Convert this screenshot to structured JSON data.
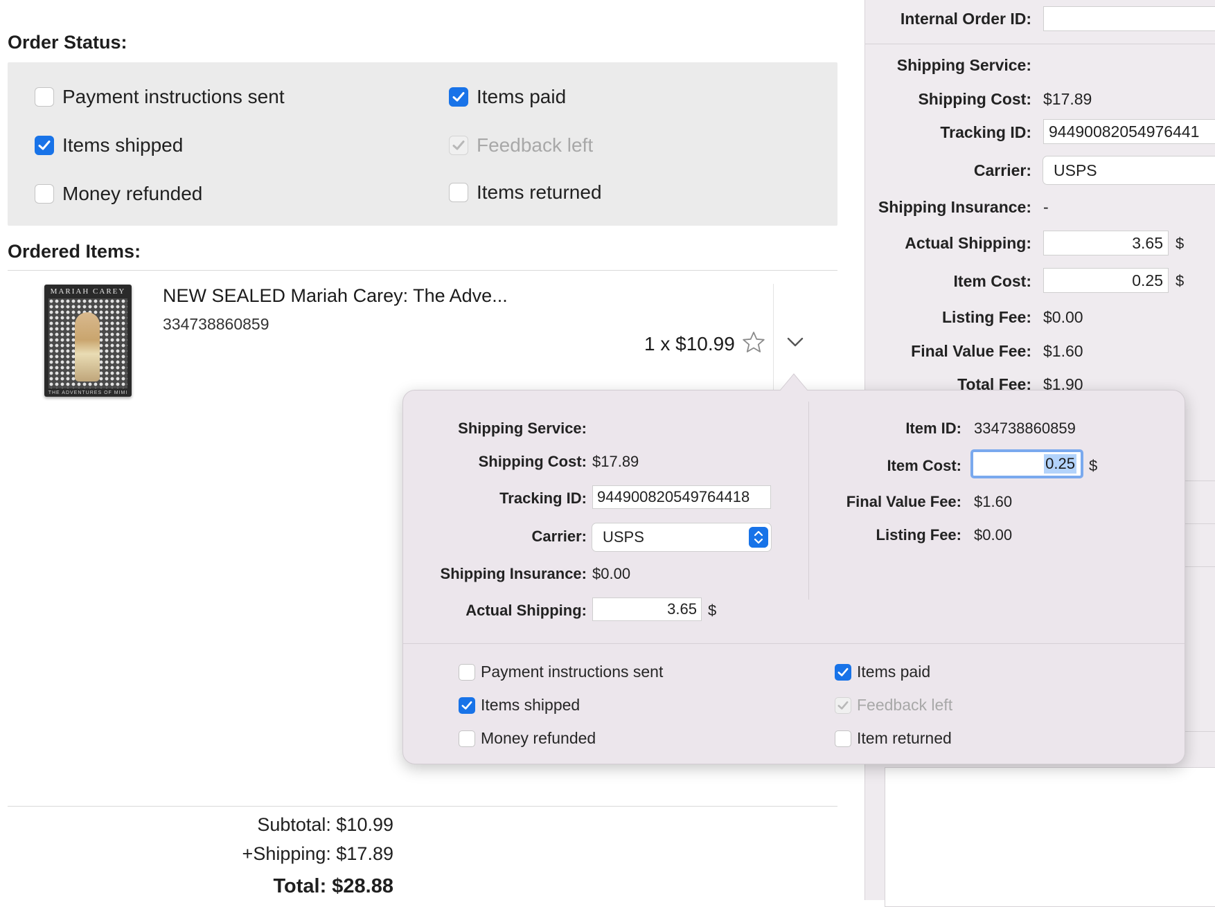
{
  "main": {
    "order_status_title": "Order Status:",
    "ordered_items_title": "Ordered Items:",
    "status_checkboxes": [
      {
        "label": "Payment instructions sent",
        "checked": false,
        "disabled": false
      },
      {
        "label": "Items paid",
        "checked": true,
        "disabled": false
      },
      {
        "label": "Items shipped",
        "checked": true,
        "disabled": false
      },
      {
        "label": "Feedback left",
        "checked": true,
        "disabled": true
      },
      {
        "label": "Money refunded",
        "checked": false,
        "disabled": false
      },
      {
        "label": "Items returned",
        "checked": false,
        "disabled": false
      }
    ],
    "item": {
      "title": "NEW SEALED Mariah Carey: The Adve...",
      "id": "334738860859",
      "price": "1 x $10.99",
      "thumb_brand": "MARIAH CAREY",
      "thumb_footer": "THE ADVENTURES OF MIMI"
    },
    "totals": {
      "subtotal": "Subtotal: $10.99",
      "shipping": "+Shipping: $17.89",
      "total": "Total: $28.88"
    }
  },
  "side": {
    "internal_order_id_label": "Internal Order ID:",
    "internal_order_id_value": "",
    "shipping_service_label": "Shipping Service:",
    "shipping_cost_label": "Shipping Cost:",
    "shipping_cost_value": "$17.89",
    "tracking_id_label": "Tracking ID:",
    "tracking_id_value": "94490082054976441",
    "carrier_label": "Carrier:",
    "carrier_value": "USPS",
    "shipping_insurance_label": "Shipping Insurance:",
    "shipping_insurance_value": "-",
    "actual_shipping_label": "Actual Shipping:",
    "actual_shipping_value": "3.65",
    "item_cost_label": "Item Cost:",
    "item_cost_value": "0.25",
    "listing_fee_label": "Listing Fee:",
    "listing_fee_value": "$0.00",
    "final_value_fee_label": "Final Value Fee:",
    "final_value_fee_value": "$1.60",
    "total_fee_label": "Total Fee:",
    "total_fee_value": "$1.90",
    "currency": "$"
  },
  "popover": {
    "shipping_service_label": "Shipping Service:",
    "shipping_cost_label": "Shipping Cost:",
    "shipping_cost_value": "$17.89",
    "tracking_id_label": "Tracking ID:",
    "tracking_id_value": "944900820549764418",
    "carrier_label": "Carrier:",
    "carrier_value": "USPS",
    "shipping_insurance_label": "Shipping Insurance:",
    "shipping_insurance_value": "$0.00",
    "actual_shipping_label": "Actual Shipping:",
    "actual_shipping_value": "3.65",
    "item_id_label": "Item ID:",
    "item_id_value": "334738860859",
    "item_cost_label": "Item Cost:",
    "item_cost_value": "0.25",
    "final_value_fee_label": "Final Value Fee:",
    "final_value_fee_value": "$1.60",
    "listing_fee_label": "Listing Fee:",
    "listing_fee_value": "$0.00",
    "currency": "$",
    "checkboxes": [
      {
        "label": "Payment instructions sent",
        "checked": false,
        "disabled": false
      },
      {
        "label": "Items paid",
        "checked": true,
        "disabled": false
      },
      {
        "label": "Items shipped",
        "checked": true,
        "disabled": false
      },
      {
        "label": "Feedback left",
        "checked": true,
        "disabled": true
      },
      {
        "label": "Money refunded",
        "checked": false,
        "disabled": false
      },
      {
        "label": "Item returned",
        "checked": false,
        "disabled": false
      }
    ]
  },
  "colors": {
    "accent": "#1873e8",
    "focus_ring": "#7aa9ee",
    "selection": "#b3d3fb",
    "status_box": "#ebebeb",
    "popover_bg": "#ece6ec",
    "side_pane_bg": "#efebef"
  },
  "icons": {
    "favorite": "star-icon",
    "expand": "chevron-down-icon",
    "checkbox_check": "checkmark-icon",
    "carrier_select": "up-down-stepper-icon"
  }
}
